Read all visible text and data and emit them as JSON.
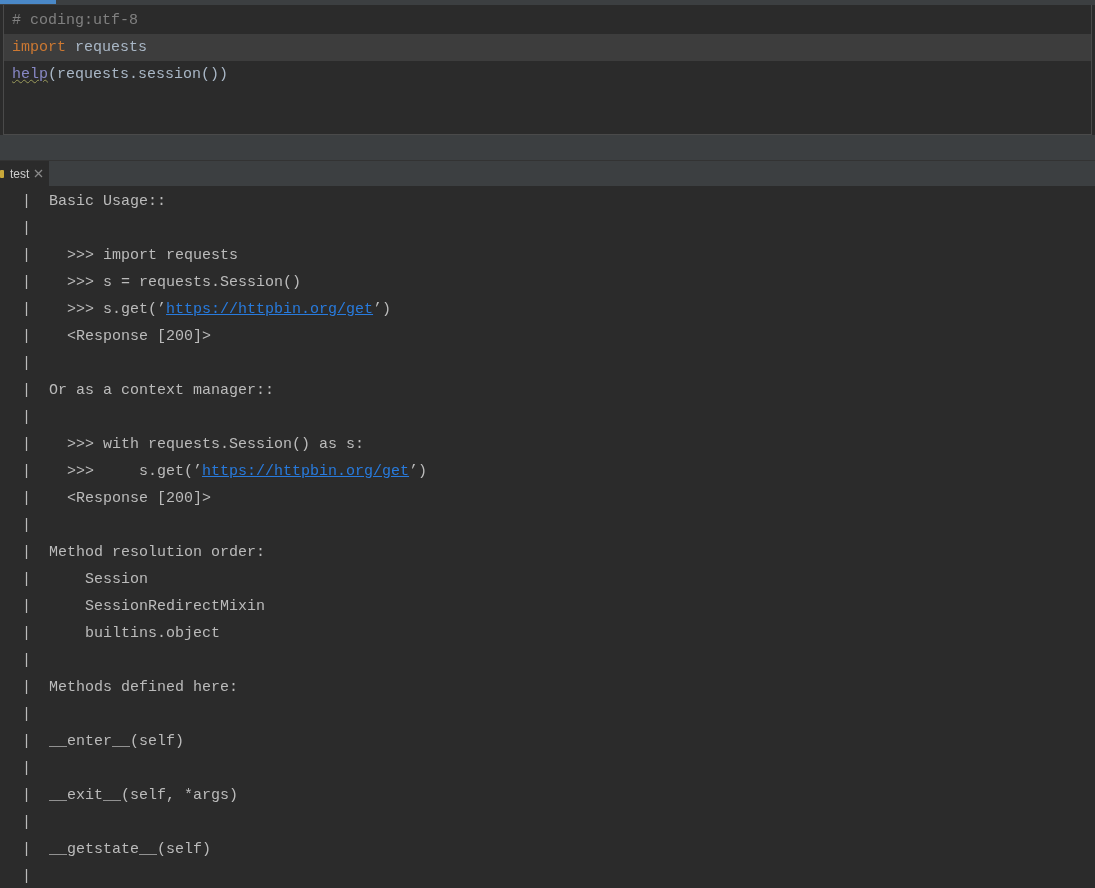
{
  "editor": {
    "lines": [
      {
        "current": false,
        "tokens": [
          {
            "text": "# coding:utf-8",
            "kind": "comment"
          }
        ]
      },
      {
        "current": true,
        "tokens": [
          {
            "text": "import",
            "kind": "keyword"
          },
          {
            "text": " requests",
            "kind": "plain"
          }
        ]
      },
      {
        "current": false,
        "tokens": [
          {
            "text": "help",
            "kind": "warned"
          },
          {
            "text": "(requests.session())",
            "kind": "plain"
          }
        ]
      }
    ]
  },
  "run_panel": {
    "tabs": [
      {
        "label": "test",
        "selected": true
      }
    ],
    "output": [
      {
        "parts": [
          {
            "text": "|  Basic Usage::",
            "kind": "text"
          }
        ]
      },
      {
        "parts": [
          {
            "text": "|",
            "kind": "text"
          }
        ]
      },
      {
        "parts": [
          {
            "text": "|    >>> import requests",
            "kind": "text"
          }
        ]
      },
      {
        "parts": [
          {
            "text": "|    >>> s = requests.Session()",
            "kind": "text"
          }
        ]
      },
      {
        "parts": [
          {
            "text": "|    >>> s.get(’",
            "kind": "text"
          },
          {
            "text": "https://httpbin.org/get",
            "kind": "link"
          },
          {
            "text": "’)",
            "kind": "text"
          }
        ]
      },
      {
        "parts": [
          {
            "text": "|    <Response [200]>",
            "kind": "text"
          }
        ]
      },
      {
        "parts": [
          {
            "text": "|",
            "kind": "text"
          }
        ]
      },
      {
        "parts": [
          {
            "text": "|  Or as a context manager::",
            "kind": "text"
          }
        ]
      },
      {
        "parts": [
          {
            "text": "|",
            "kind": "text"
          }
        ]
      },
      {
        "parts": [
          {
            "text": "|    >>> with requests.Session() as s:",
            "kind": "text"
          }
        ]
      },
      {
        "parts": [
          {
            "text": "|    >>>     s.get(’",
            "kind": "text"
          },
          {
            "text": "https://httpbin.org/get",
            "kind": "link"
          },
          {
            "text": "’)",
            "kind": "text"
          }
        ]
      },
      {
        "parts": [
          {
            "text": "|    <Response [200]>",
            "kind": "text"
          }
        ]
      },
      {
        "parts": [
          {
            "text": "|",
            "kind": "text"
          }
        ]
      },
      {
        "parts": [
          {
            "text": "|  Method resolution order:",
            "kind": "text"
          }
        ]
      },
      {
        "parts": [
          {
            "text": "|      Session",
            "kind": "text"
          }
        ]
      },
      {
        "parts": [
          {
            "text": "|      SessionRedirectMixin",
            "kind": "text"
          }
        ]
      },
      {
        "parts": [
          {
            "text": "|      builtins.object",
            "kind": "text"
          }
        ]
      },
      {
        "parts": [
          {
            "text": "|",
            "kind": "text"
          }
        ]
      },
      {
        "parts": [
          {
            "text": "|  Methods defined here:",
            "kind": "text"
          }
        ]
      },
      {
        "parts": [
          {
            "text": "|",
            "kind": "text"
          }
        ]
      },
      {
        "parts": [
          {
            "text": "|  __enter__(self)",
            "kind": "text"
          }
        ]
      },
      {
        "parts": [
          {
            "text": "|",
            "kind": "text"
          }
        ]
      },
      {
        "parts": [
          {
            "text": "|  __exit__(self, *args)",
            "kind": "text"
          }
        ]
      },
      {
        "parts": [
          {
            "text": "|",
            "kind": "text"
          }
        ]
      },
      {
        "parts": [
          {
            "text": "|  __getstate__(self)",
            "kind": "text"
          }
        ]
      },
      {
        "parts": [
          {
            "text": "|",
            "kind": "text"
          }
        ]
      }
    ]
  }
}
